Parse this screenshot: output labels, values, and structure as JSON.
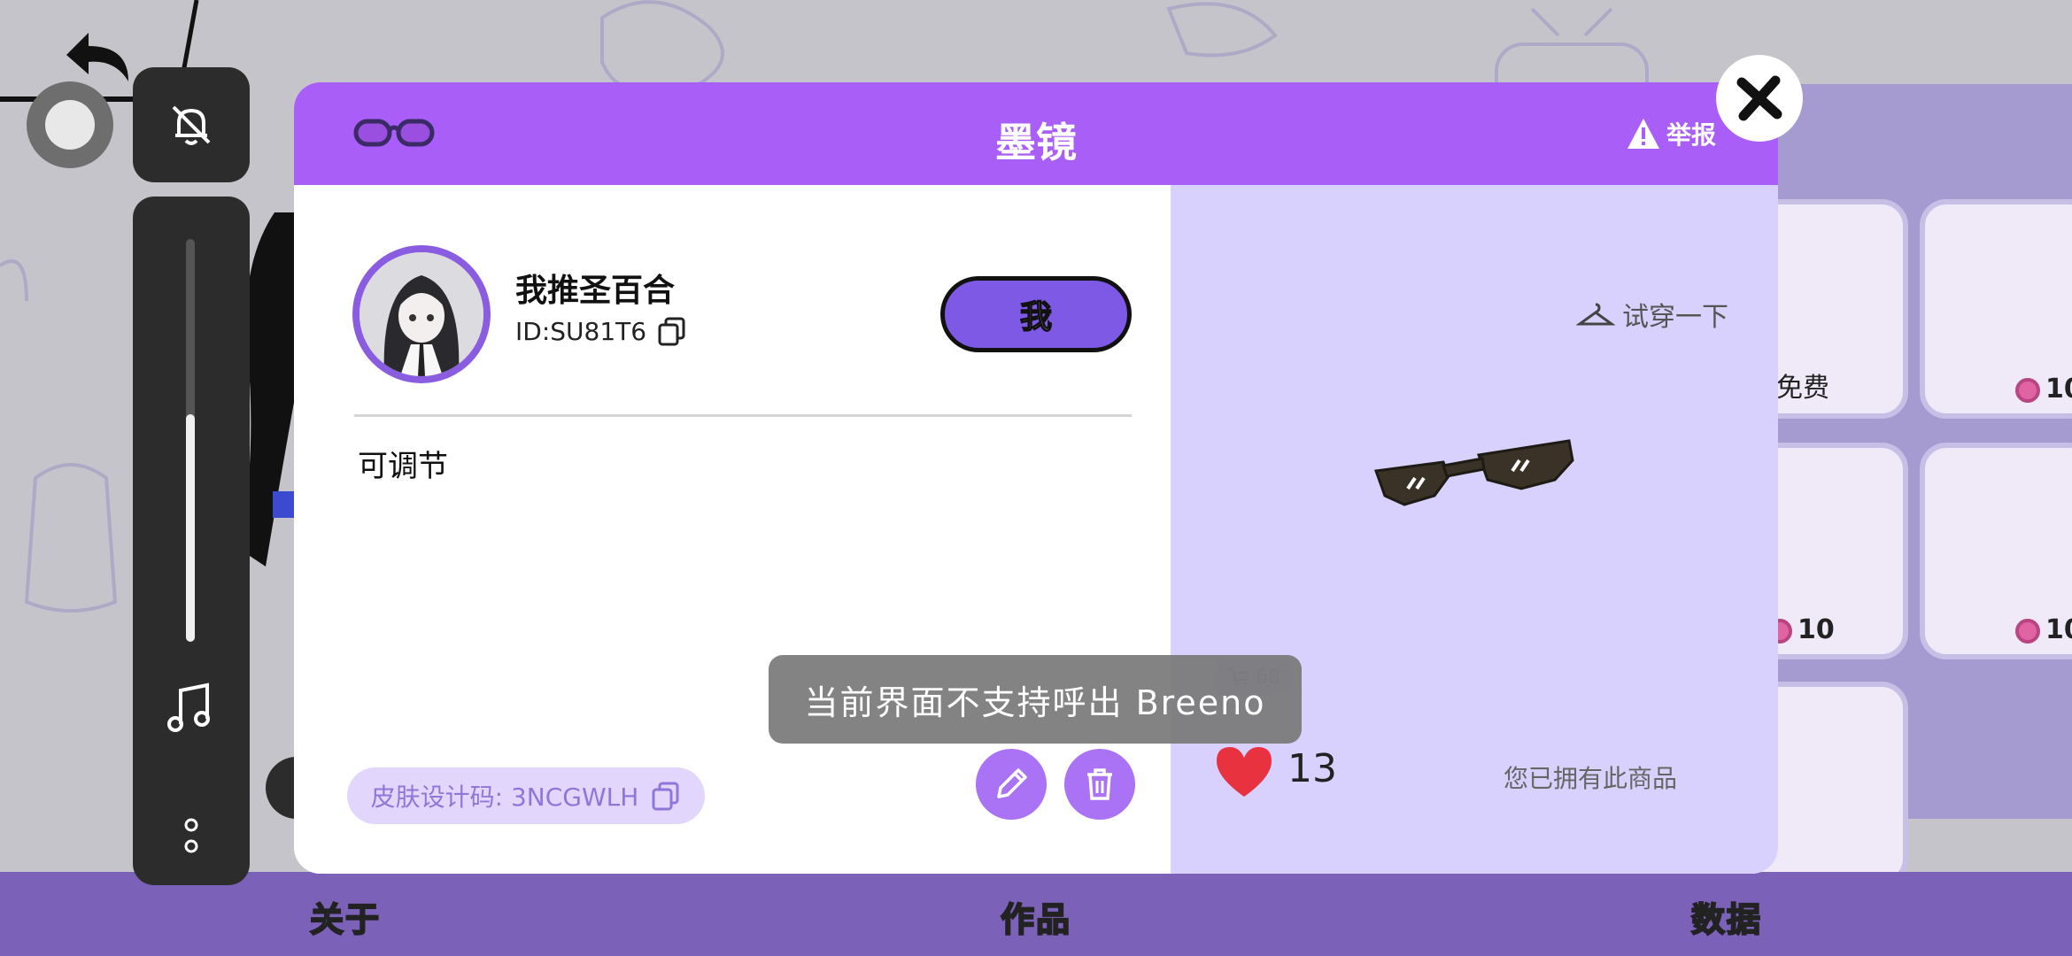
{
  "modal": {
    "title": "墨镜",
    "report_label": "举报",
    "user": {
      "name": "我推圣百合",
      "id": "ID:SU81T6",
      "me_button": "我"
    },
    "description": "可调节",
    "skin_code": "皮肤设计码: 3NCGWLH",
    "try_on_label": "试穿一下",
    "cart_count": "68",
    "likes": "13",
    "owned_text": "您已拥有此商品"
  },
  "toast": "当前界面不支持呼出 Breeno",
  "background_shop": {
    "tile_labels": [
      "免费",
      "10",
      "10",
      "10"
    ]
  },
  "bottom_nav": {
    "tabs": [
      "关于",
      "作品",
      "数据"
    ],
    "active": "作品"
  },
  "colors": {
    "header": "#a95ef8",
    "preview_bg": "#d9d1fd",
    "me_button": "#7d59e6",
    "nav_bar": "#7b61b8",
    "active_tab": "#f6a623"
  }
}
